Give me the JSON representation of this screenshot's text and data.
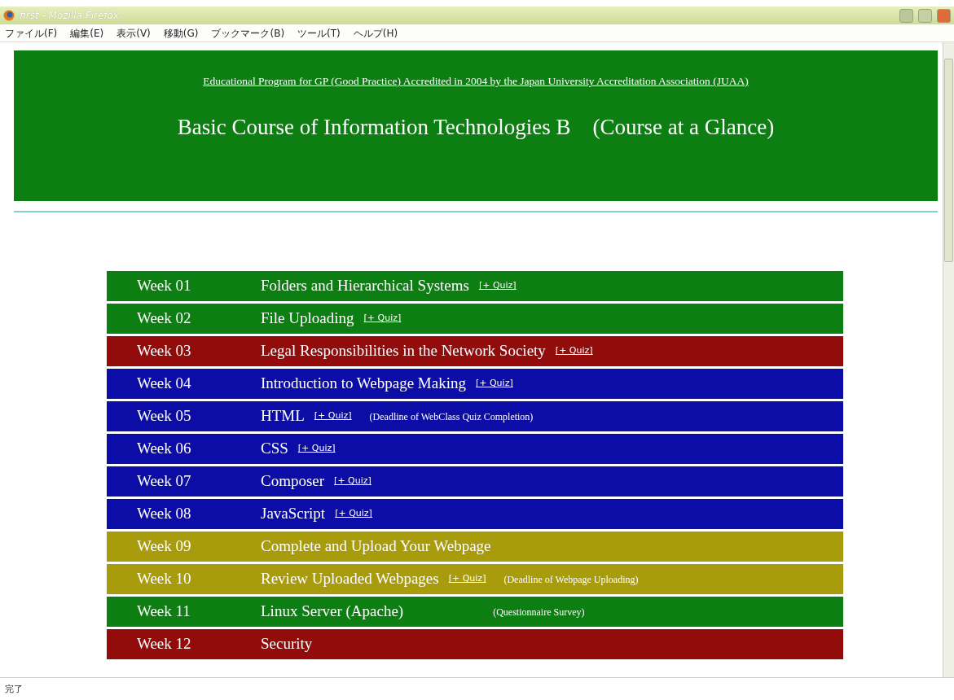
{
  "window": {
    "title": "first - Mozilla Firefox"
  },
  "menu": [
    "ファイル(F)",
    "編集(E)",
    "表示(V)",
    "移動(G)",
    "ブックマーク(B)",
    "ツール(T)",
    "ヘルプ(H)"
  ],
  "header": {
    "accreditation_link": "Educational Program for GP (Good Practice) Accredited in 2004 by the Japan University Accreditation Association (JUAA)",
    "title": "Basic Course of Information Technologies B　(Course at a Glance)"
  },
  "weeks": [
    {
      "week": "Week 01",
      "topic": "Folders and Hierarchical Systems",
      "quiz": "[+ Quiz]",
      "color": "#0d7f12"
    },
    {
      "week": "Week 02",
      "topic": "File Uploading",
      "quiz": "[+ Quiz]",
      "color": "#0d7f12"
    },
    {
      "week": "Week 03",
      "topic": "Legal Responsibilities in the Network Society",
      "quiz": "[+ Quiz]",
      "color": "#930c0c"
    },
    {
      "week": "Week 04",
      "topic": "Introduction to Webpage Making",
      "quiz": "[+ Quiz]",
      "color": "#0c0da6"
    },
    {
      "week": "Week 05",
      "topic": "HTML",
      "quiz": "[+ Quiz]",
      "note": "(Deadline of WebClass Quiz Completion)",
      "color": "#0c0da6"
    },
    {
      "week": "Week 06",
      "topic": "CSS",
      "quiz": "[+ Quiz]",
      "color": "#0c0da6"
    },
    {
      "week": "Week 07",
      "topic": "Composer",
      "quiz": "[+ Quiz]",
      "color": "#0c0da6"
    },
    {
      "week": "Week 08",
      "topic": "JavaScript",
      "quiz": "[+ Quiz]",
      "color": "#0c0da6"
    },
    {
      "week": "Week 09",
      "topic": "Complete and Upload Your Webpage",
      "color": "#a89c0c"
    },
    {
      "week": "Week 10",
      "topic": "Review Uploaded Webpages",
      "quiz": "[+ Quiz]",
      "note": "(Deadline of Webpage Uploading)",
      "color": "#a89c0c"
    },
    {
      "week": "Week 11",
      "topic": "Linux Server (Apache)",
      "note": "(Questionnaire Survey)",
      "note_far": true,
      "color": "#0d7f12"
    },
    {
      "week": "Week 12",
      "topic": "Security",
      "color": "#930c0c"
    }
  ],
  "status_bar": "完了"
}
